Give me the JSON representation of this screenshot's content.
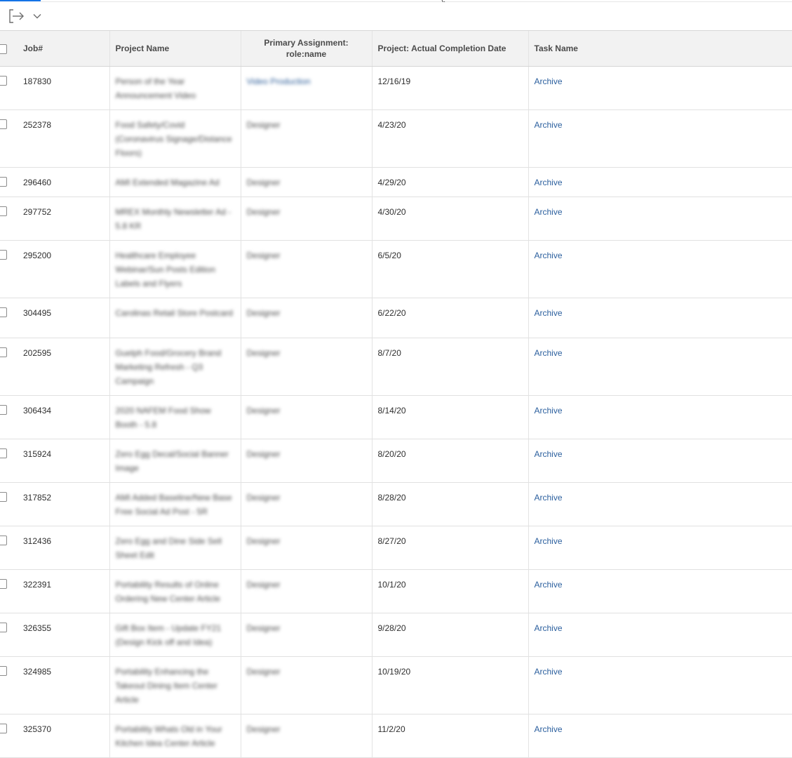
{
  "toolbar": {
    "export_icon": "export-icon",
    "dropdown_icon": "chevron-down-icon"
  },
  "table": {
    "headers": {
      "job": "Job#",
      "project": "Project Name",
      "role_line1": "Primary Assignment:",
      "role_line2": "role:name",
      "date": "Project: Actual Completion Date",
      "task": "Task Name"
    },
    "rows": [
      {
        "job": "187830",
        "project": "Person of the Year Announcement Video",
        "role": "Video Production",
        "date": "12/16/19",
        "task": "Archive"
      },
      {
        "job": "252378",
        "project": "Food Safety/Covid (Coronavirus Signage/Distance Floors)",
        "role": "Designer",
        "date": "4/23/20",
        "task": "Archive"
      },
      {
        "job": "296460",
        "project": "AMI Extended Magazine Ad",
        "role": "Designer",
        "date": "4/29/20",
        "task": "Archive"
      },
      {
        "job": "297752",
        "project": "MREX Monthly Newsletter Ad - 5.8 KR",
        "role": "Designer",
        "date": "4/30/20",
        "task": "Archive"
      },
      {
        "job": "295200",
        "project": "Healthcare Employee Webinar/Sun Posts Edition Labels and Flyers",
        "role": "Designer",
        "date": "6/5/20",
        "task": "Archive"
      },
      {
        "job": "304495",
        "project": "Carolinas Retail Store Postcard",
        "role": "Designer",
        "date": "6/22/20",
        "task": "Archive"
      },
      {
        "job": "202595",
        "project": "Guelph Food/Grocery Brand Marketing Refresh - Q3 Campaign",
        "role": "Designer",
        "date": "8/7/20",
        "task": "Archive"
      },
      {
        "job": "306434",
        "project": "2020 NAFEM Food Show Booth - 5.8",
        "role": "Designer",
        "date": "8/14/20",
        "task": "Archive"
      },
      {
        "job": "315924",
        "project": "Zero Egg Decal/Social Banner Image",
        "role": "Designer",
        "date": "8/20/20",
        "task": "Archive"
      },
      {
        "job": "317852",
        "project": "AMI Added Baseline/New Base Free Social Ad Post - 5R",
        "role": "Designer",
        "date": "8/28/20",
        "task": "Archive"
      },
      {
        "job": "312436",
        "project": "Zero Egg and Dine Side Sell Sheet Edit",
        "role": "Designer",
        "date": "8/27/20",
        "task": "Archive"
      },
      {
        "job": "322391",
        "project": "Portability Results of Online Ordering New Center Article",
        "role": "Designer",
        "date": "10/1/20",
        "task": "Archive"
      },
      {
        "job": "326355",
        "project": "Gift Box Item - Update FY21 (Design Kick off and Idea)",
        "role": "Designer",
        "date": "9/28/20",
        "task": "Archive"
      },
      {
        "job": "324985",
        "project": "Portability Enhancing the Takeout Dining Item Center Article",
        "role": "Designer",
        "date": "10/19/20",
        "task": "Archive"
      },
      {
        "job": "325370",
        "project": "Portability Whats Old in Your Kitchen Idea Center Article",
        "role": "Designer",
        "date": "11/2/20",
        "task": "Archive"
      }
    ]
  }
}
